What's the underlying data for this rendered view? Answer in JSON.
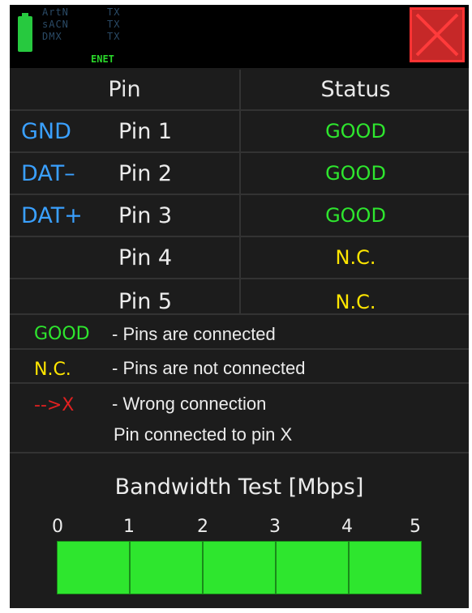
{
  "status_bar": {
    "protocols": [
      {
        "name": "ArtN",
        "state": "TX"
      },
      {
        "name": "sACN",
        "state": "TX"
      },
      {
        "name": "DMX",
        "state": "TX"
      }
    ],
    "network": "ENET",
    "icons": {
      "battery": "battery-icon",
      "close": "close-x-icon"
    },
    "colors": {
      "battery": "#27c93f",
      "close_bg": "#c62828",
      "close_x": "#ff3333"
    }
  },
  "table": {
    "headers": {
      "pin": "Pin",
      "status": "Status"
    },
    "rows": [
      {
        "signal": "GND",
        "pin": "Pin 1",
        "status": "GOOD",
        "status_type": "good"
      },
      {
        "signal": "DAT–",
        "pin": "Pin 2",
        "status": "GOOD",
        "status_type": "good"
      },
      {
        "signal": "DAT+",
        "pin": "Pin 3",
        "status": "GOOD",
        "status_type": "good"
      },
      {
        "signal": "",
        "pin": "Pin 4",
        "status": "N.C.",
        "status_type": "nc"
      },
      {
        "signal": "",
        "pin": "Pin 5",
        "status": "N.C.",
        "status_type": "nc"
      }
    ],
    "colors": {
      "good": "#2ee62e",
      "nc": "#ffe600",
      "signal": "#3aa0ff"
    }
  },
  "legend": [
    {
      "key": "GOOD",
      "desc": "- Pins are connected",
      "desc2": ""
    },
    {
      "key": "N.C.",
      "desc": "- Pins are not connected",
      "desc2": ""
    },
    {
      "key": "-->X",
      "desc": "- Wrong connection",
      "desc2": "Pin connected to pin X"
    }
  ],
  "legend_colors": {
    "good": "#2ee62e",
    "nc": "#ffe600",
    "wrong": "#e02020"
  },
  "bandwidth": {
    "title": "Bandwidth Test [Mbps]",
    "ticks": [
      "0",
      "1",
      "2",
      "3",
      "4",
      "5"
    ],
    "value_mbps": 5,
    "max_mbps": 5,
    "bar_color": "#2ee62e"
  }
}
